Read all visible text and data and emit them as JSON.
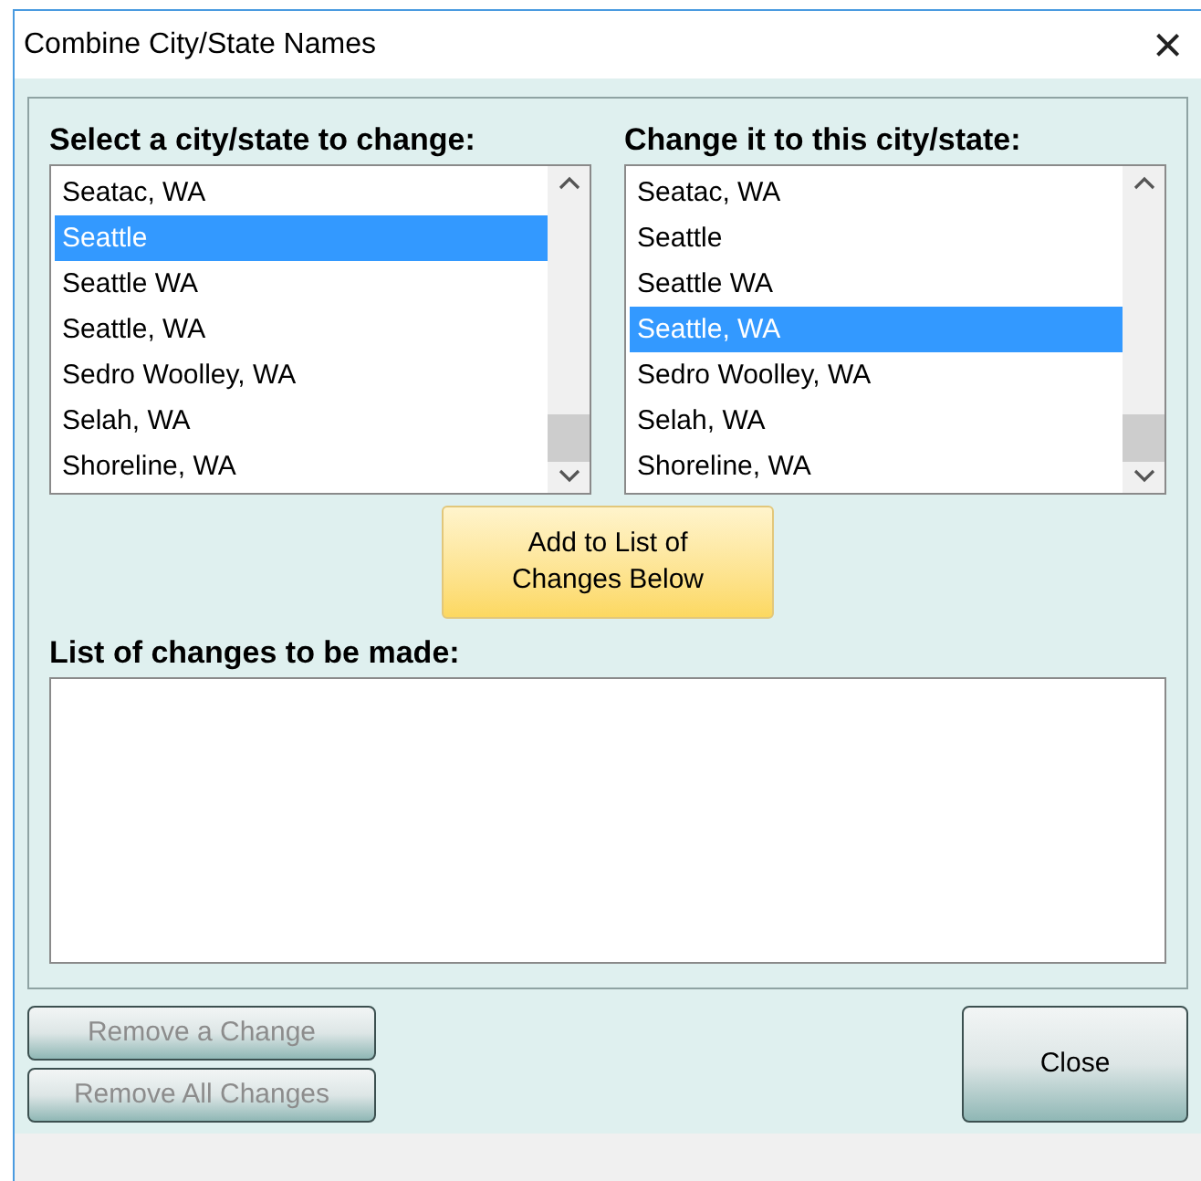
{
  "window": {
    "title": "Combine City/State Names",
    "close": "×"
  },
  "lists": [
    {
      "label": "Select a city/state to change:",
      "items": [
        {
          "text": "Seatac, WA",
          "selected": false
        },
        {
          "text": "Seattle",
          "selected": true
        },
        {
          "text": "Seattle WA",
          "selected": false
        },
        {
          "text": "Seattle, WA",
          "selected": false
        },
        {
          "text": "Sedro Woolley, WA",
          "selected": false
        },
        {
          "text": "Selah, WA",
          "selected": false
        },
        {
          "text": "Shoreline, WA",
          "selected": false
        }
      ]
    },
    {
      "label": "Change it to this city/state:",
      "items": [
        {
          "text": "Seatac, WA",
          "selected": false
        },
        {
          "text": "Seattle",
          "selected": false
        },
        {
          "text": "Seattle WA",
          "selected": false
        },
        {
          "text": "Seattle, WA",
          "selected": true
        },
        {
          "text": "Sedro Woolley, WA",
          "selected": false
        },
        {
          "text": "Selah, WA",
          "selected": false
        },
        {
          "text": "Shoreline, WA",
          "selected": false
        }
      ]
    }
  ],
  "add_button": {
    "line1": "Add to List of",
    "line2": "Changes Below"
  },
  "changes": {
    "label": "List of changes to be made:"
  },
  "buttons": [
    {
      "label": "Remove a Change",
      "disabled": true
    },
    {
      "label": "Remove All Changes",
      "disabled": true
    }
  ],
  "close_button": {
    "label": "Close",
    "disabled": false
  }
}
